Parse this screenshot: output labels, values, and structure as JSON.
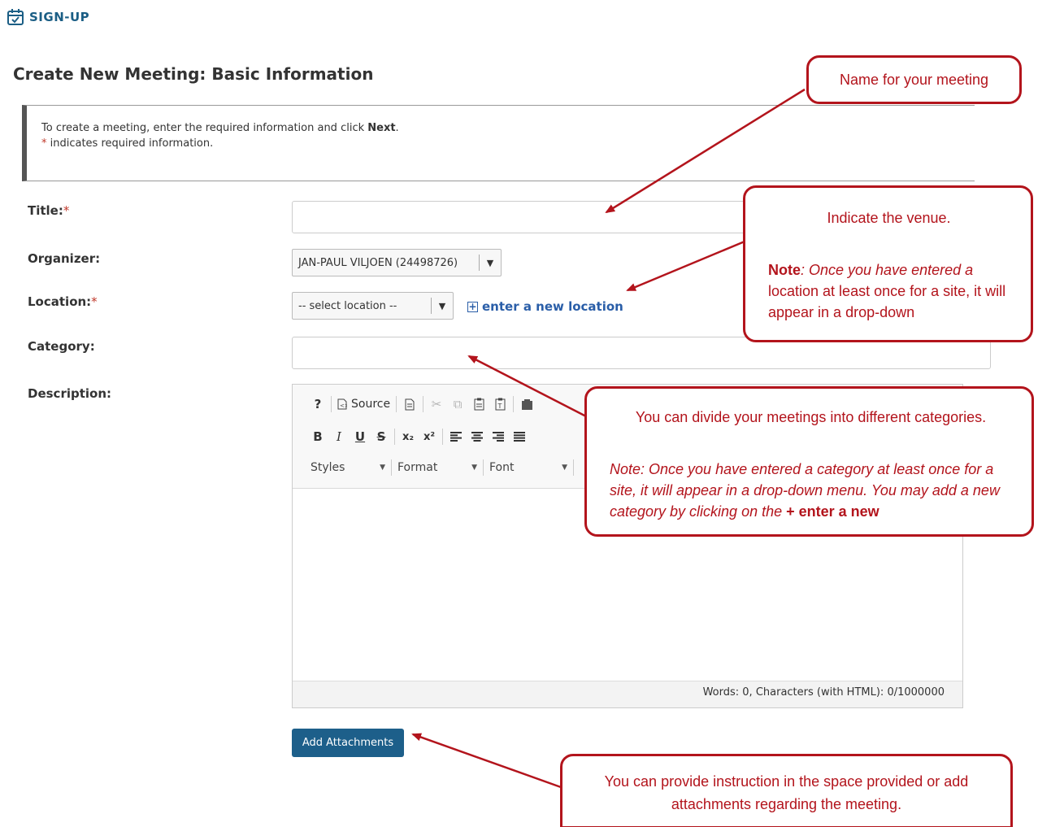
{
  "header": {
    "tool_icon": "calendar-check-icon",
    "tool_name": "SIGN-UP",
    "page_title": "Create New Meeting: Basic Information"
  },
  "instructions": {
    "line1_prefix": "To create a meeting, enter the required information and click ",
    "line1_bold": "Next",
    "line1_suffix": ".",
    "required_star": "*",
    "line2": " indicates required information."
  },
  "form": {
    "title_label": "Title:",
    "title_value": "",
    "organizer_label": "Organizer:",
    "organizer_value": "JAN-PAUL VILJOEN (24498726)",
    "location_label": "Location:",
    "location_value": "-- select location --",
    "new_location_link": "enter a new location",
    "category_label": "Category:",
    "category_value": "",
    "description_label": "Description:",
    "required_star": "*"
  },
  "editor": {
    "row1": [
      "?",
      "Source"
    ],
    "row2": [
      "B",
      "I",
      "U",
      "S",
      "x₂",
      "x²"
    ],
    "combos": [
      "Styles",
      "Format",
      "Font"
    ],
    "status": "Words: 0, Characters (with HTML): 0/1000000"
  },
  "attach_button": "Add Attachments",
  "callouts": {
    "name": "Name for your meeting",
    "venue_title": "Indicate the venue.",
    "venue_note_label": "Note",
    "venue_note_italic": ": Once you have entered a",
    "venue_note_rest": "location at least once for a site, it will appear in a drop-down",
    "category_title": "You can divide your meetings into different categories.",
    "category_note": "Note: Once you have entered a category at least once for a site, it will appear in a drop-down menu. You may add a new category by clicking on the ",
    "category_note_bold": "+ enter a new",
    "attach": "You can provide instruction in the space provided or add attachments regarding the meeting."
  },
  "colors": {
    "callout_red": "#b3141c",
    "brand_blue": "#1d5f8a",
    "link_blue": "#2a5ea8"
  }
}
